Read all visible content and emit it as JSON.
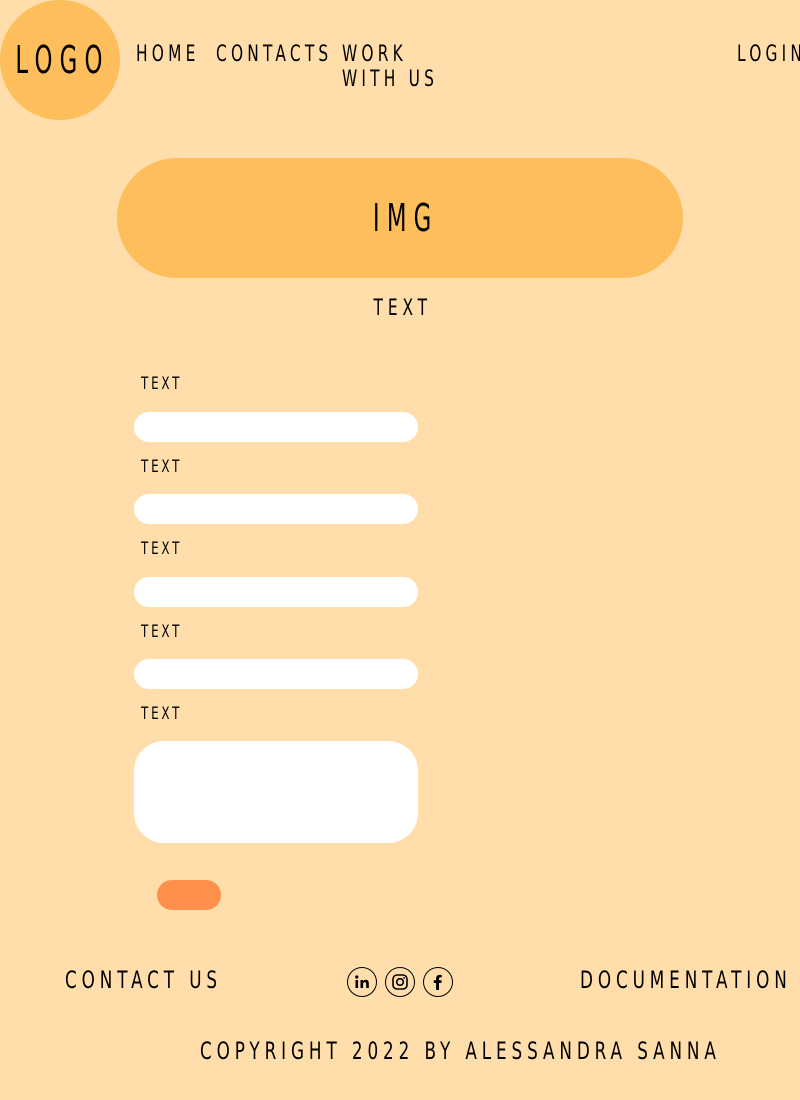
{
  "header": {
    "logo": "LOGO",
    "nav": [
      "HOME",
      "CONTACTS",
      "WORK WITH US"
    ],
    "login": "LOGIN"
  },
  "hero": {
    "image_label": "IMG",
    "text": "TEXT"
  },
  "form": {
    "fields": [
      {
        "label": "TEXT",
        "value": ""
      },
      {
        "label": "TEXT",
        "value": ""
      },
      {
        "label": "TEXT",
        "value": ""
      },
      {
        "label": "TEXT",
        "value": ""
      },
      {
        "label": "TEXT",
        "value": ""
      }
    ],
    "submit_label": ""
  },
  "footer": {
    "contact_us": "CONTACT US",
    "documentation": "DOCUMENTATION",
    "socials": [
      "linkedin-icon",
      "instagram-icon",
      "facebook-icon"
    ],
    "copyright": "COPYRIGHT 2022 BY ALESSANDRA SANNA"
  },
  "colors": {
    "background": "#FFDEAB",
    "accent": "#FFBE5C",
    "button": "#FF904C",
    "input": "#FFFFFF"
  }
}
